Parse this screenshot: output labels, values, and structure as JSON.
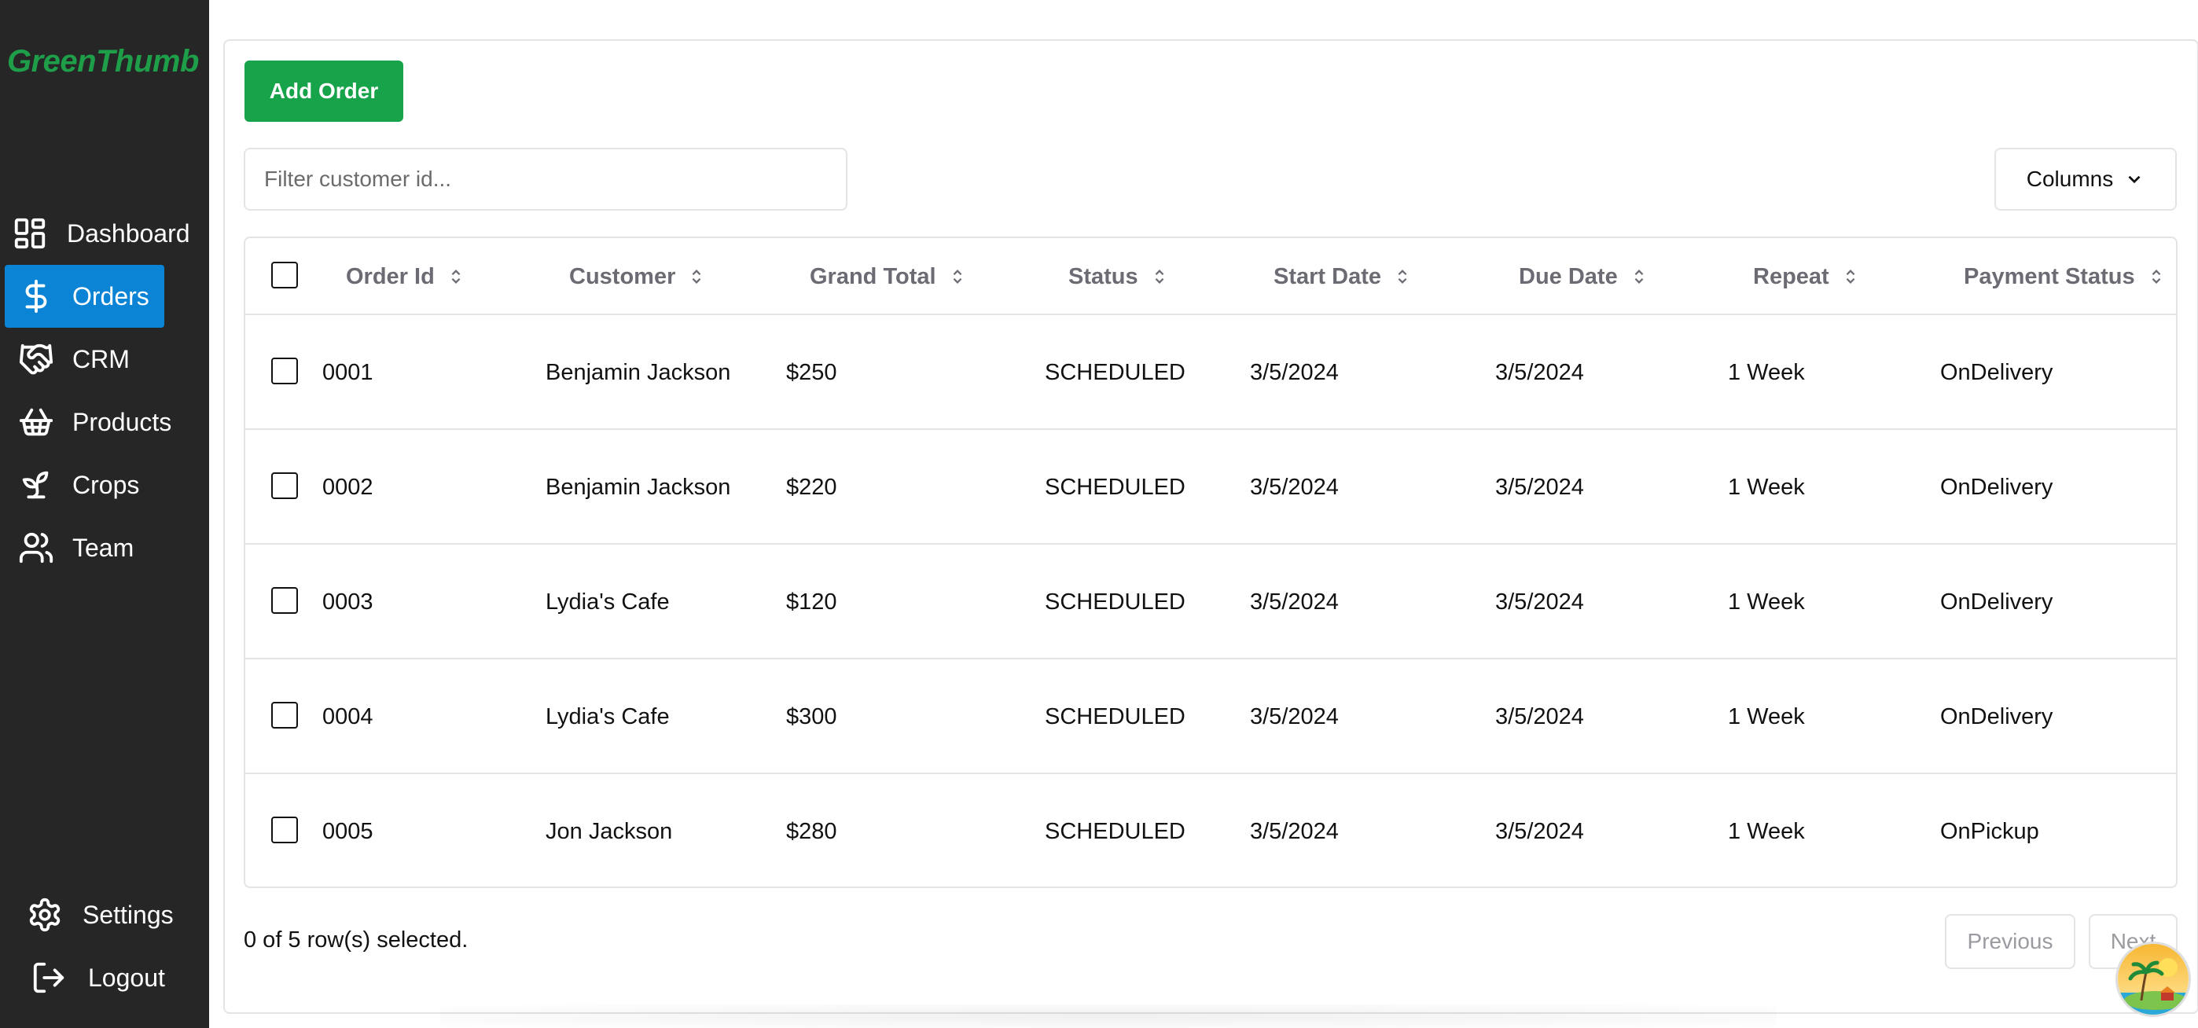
{
  "app": {
    "logo": "GreenThumb"
  },
  "sidebar": {
    "items": [
      {
        "label": "Dashboard",
        "icon": "dashboard-icon"
      },
      {
        "label": "Orders",
        "icon": "dollar-icon",
        "active": true
      },
      {
        "label": "CRM",
        "icon": "handshake-icon"
      },
      {
        "label": "Products",
        "icon": "basket-icon"
      },
      {
        "label": "Crops",
        "icon": "sprout-icon"
      },
      {
        "label": "Team",
        "icon": "users-icon"
      }
    ],
    "bottom": [
      {
        "label": "Settings",
        "icon": "gear-icon"
      },
      {
        "label": "Logout",
        "icon": "logout-icon"
      }
    ]
  },
  "toolbar": {
    "add_label": "Add Order",
    "filter_placeholder": "Filter customer id...",
    "filter_value": "",
    "columns_label": "Columns"
  },
  "table": {
    "headers": [
      "Order Id",
      "Customer",
      "Grand Total",
      "Status",
      "Start Date",
      "Due Date",
      "Repeat",
      "Payment Status"
    ],
    "rows": [
      [
        "0001",
        "Benjamin Jackson",
        "$250",
        "SCHEDULED",
        "3/5/2024",
        "3/5/2024",
        "1 Week",
        "OnDelivery"
      ],
      [
        "0002",
        "Benjamin Jackson",
        "$220",
        "SCHEDULED",
        "3/5/2024",
        "3/5/2024",
        "1 Week",
        "OnDelivery"
      ],
      [
        "0003",
        "Lydia's Cafe",
        "$120",
        "SCHEDULED",
        "3/5/2024",
        "3/5/2024",
        "1 Week",
        "OnDelivery"
      ],
      [
        "0004",
        "Lydia's Cafe",
        "$300",
        "SCHEDULED",
        "3/5/2024",
        "3/5/2024",
        "1 Week",
        "OnDelivery"
      ],
      [
        "0005",
        "Jon Jackson",
        "$280",
        "SCHEDULED",
        "3/5/2024",
        "3/5/2024",
        "1 Week",
        "OnPickup"
      ]
    ]
  },
  "footer": {
    "selection_text": "0 of 5 row(s) selected.",
    "previous_label": "Previous",
    "next_label": "Next"
  },
  "colors": {
    "sidebar_bg": "#262626",
    "active_nav": "#0c84d6",
    "brand_green": "#16a34a",
    "logo_green": "#1f9e4a"
  }
}
